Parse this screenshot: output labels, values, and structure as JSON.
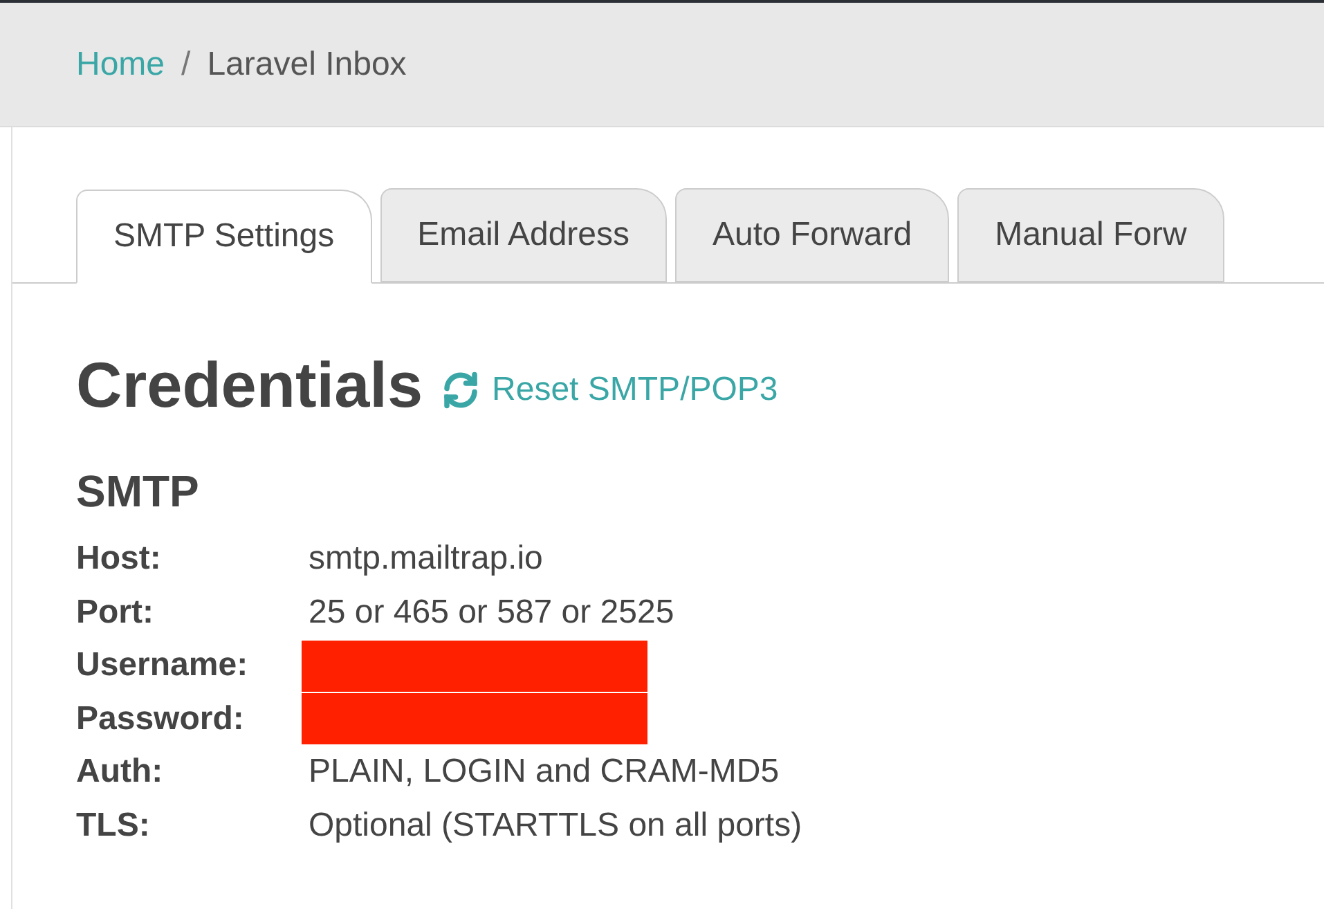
{
  "breadcrumb": {
    "items": [
      {
        "label": "Home",
        "kind": "link"
      },
      {
        "label": "Laravel Inbox",
        "kind": "current"
      }
    ],
    "separator": "/"
  },
  "tabs": [
    {
      "label": "SMTP Settings",
      "selected": true
    },
    {
      "label": "Email Address",
      "selected": false
    },
    {
      "label": "Auto Forward",
      "selected": false
    },
    {
      "label": "Manual Forw",
      "selected": false
    }
  ],
  "heading": "Credentials",
  "reset_link": "Reset SMTP/POP3",
  "section": "SMTP",
  "rows": [
    {
      "label": "Host:",
      "kind": "text",
      "value": "smtp.mailtrap.io"
    },
    {
      "label": "Port:",
      "kind": "text",
      "value": "25 or 465 or 587 or 2525"
    },
    {
      "label": "Username:",
      "kind": "redacted"
    },
    {
      "label": "Password:",
      "kind": "redacted"
    },
    {
      "label": "Auth:",
      "kind": "text",
      "value": "PLAIN, LOGIN and CRAM-MD5"
    },
    {
      "label": "TLS:",
      "kind": "text",
      "value": "Optional (STARTTLS on all ports)"
    }
  ]
}
